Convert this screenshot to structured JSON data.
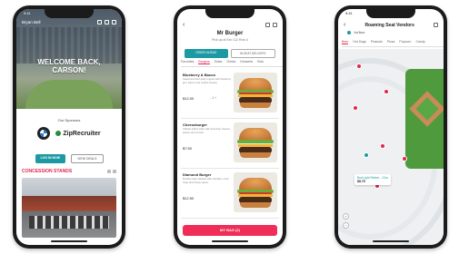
{
  "home": {
    "status_time": "9:41",
    "user_label": "Bryan Bell",
    "welcome_line1": "WELCOME BACK,",
    "welcome_line2": "CARSON!",
    "sponsors_label": "Our Sponsors",
    "sponsor_zip": "ZipRecruiter",
    "btn_primary": "LOG IN NOW",
    "btn_secondary": "VIEW DEALS",
    "section_title": "CONCESSION STANDS"
  },
  "menu": {
    "vendor_name": "Mr Burger",
    "vendor_sub": "Pick up at Sec 112 Row 4",
    "mode_on": "ORDER AHEAD",
    "mode_off": "IN-SEAT DELIVERY",
    "categories": [
      "Favorites",
      "Burgers",
      "Sides",
      "Drinks",
      "Desserts",
      "Kids"
    ],
    "active_category": "Burgers",
    "items": [
      {
        "name": "Blueberry & Bacon",
        "desc": "Seasoned beef patty topped with blueberry jam, bacon and melted cheese",
        "price": "$12.00",
        "qty": "- 1 +"
      },
      {
        "name": "Cheeseburger",
        "desc": "Classic grilled patty with american cheese, lettuce and tomato",
        "price": "$7.50",
        "qty": ""
      },
      {
        "name": "Diamond Burger",
        "desc": "Double patty stacked with cheddar, onion rings and house sauce",
        "price": "$12.50",
        "qty": ""
      }
    ],
    "cart_label": "MY BAG (2)"
  },
  "map": {
    "status_time": "9:41",
    "title": "Roaming Seat Vendors",
    "location": "1st floor",
    "filters": [
      "Beer",
      "Hot Dogs",
      "Peanuts",
      "Pizza",
      "Popcorn",
      "Candy"
    ],
    "active_filter": "Beer",
    "tooltip_name": "Bud Light Seltzer - 12oz",
    "tooltip_price": "$8.75",
    "zoom_in": "+",
    "zoom_out": "−"
  },
  "colors": {
    "accent_red": "#e0264e",
    "teal": "#1c9aa3"
  }
}
